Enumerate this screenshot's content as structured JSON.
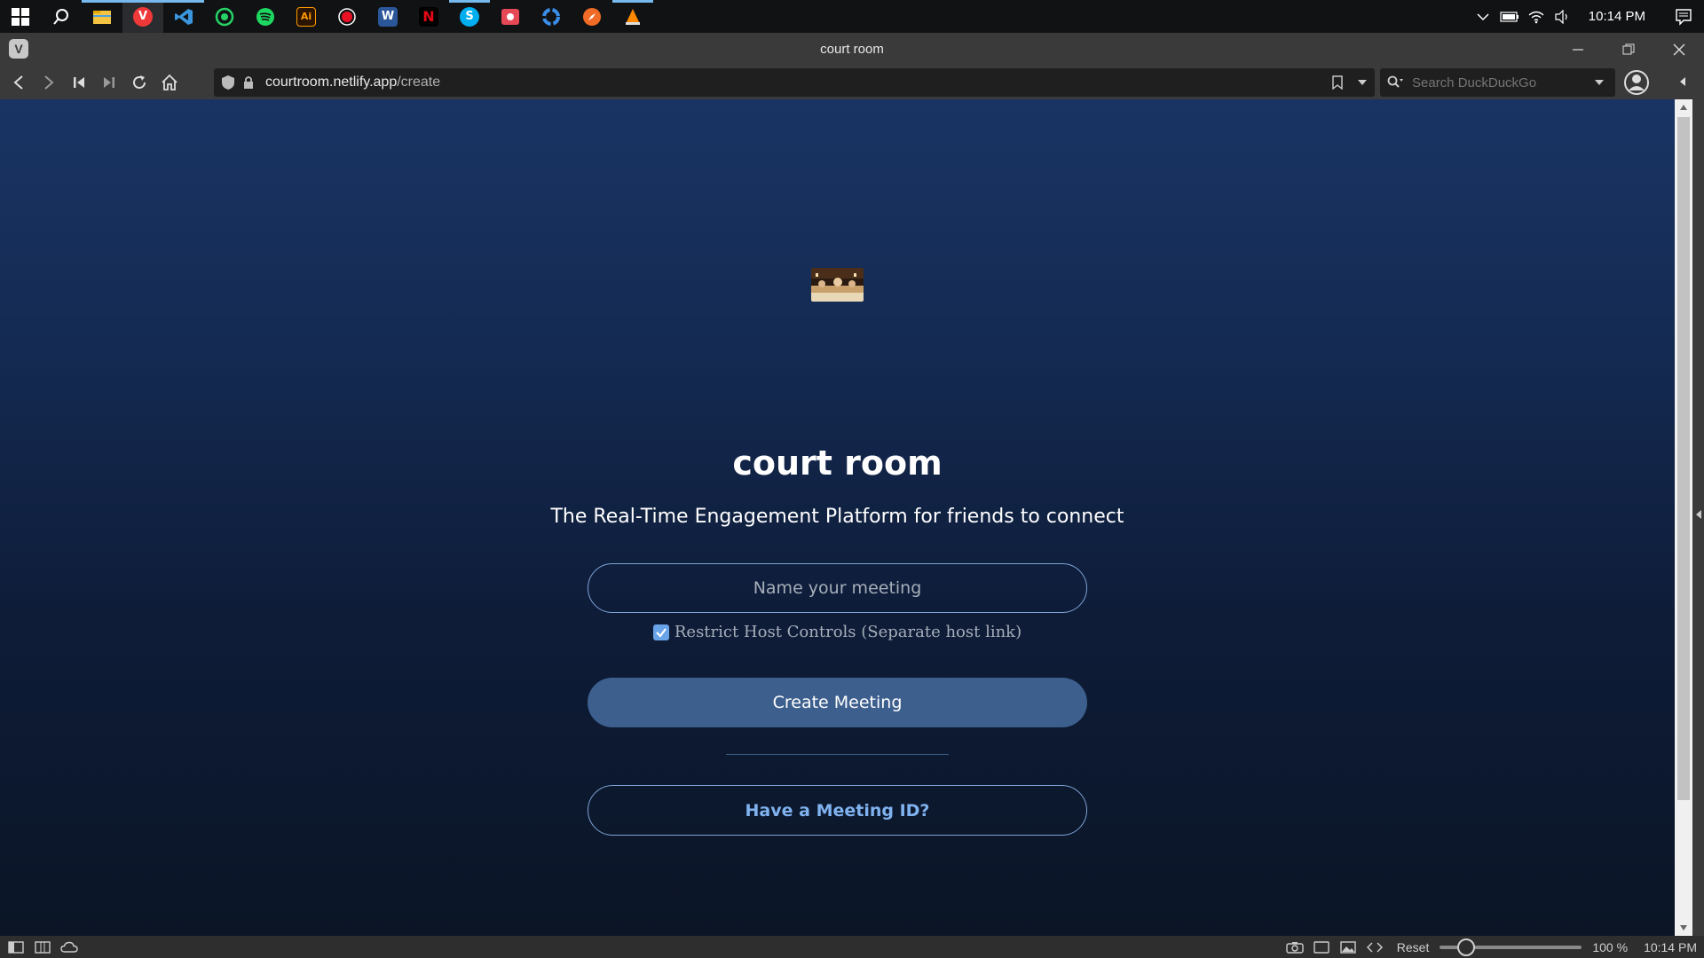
{
  "taskbar": {
    "apps": [
      {
        "name": "windows-start-icon"
      },
      {
        "name": "search-icon"
      },
      {
        "name": "file-explorer-icon",
        "color": "#f4c342"
      },
      {
        "name": "vivaldi-icon",
        "color": "#ef3939"
      },
      {
        "name": "vscode-icon",
        "color": "#3a96dd"
      },
      {
        "name": "whatsapp-icon",
        "color": "#25d366"
      },
      {
        "name": "spotify-icon",
        "color": "#1ed760"
      },
      {
        "name": "illustrator-icon",
        "color": "#ff9a00",
        "label": "Ai"
      },
      {
        "name": "record-icon",
        "color": "#e81123"
      },
      {
        "name": "word-icon",
        "color": "#2b579a",
        "label": "W"
      },
      {
        "name": "netflix-icon",
        "color": "#e50914",
        "label": "N"
      },
      {
        "name": "skype-icon",
        "color": "#00aff0",
        "label": "S"
      },
      {
        "name": "photo-icon",
        "color": "#e74856"
      },
      {
        "name": "recycle-icon",
        "color": "#3b8ee8"
      },
      {
        "name": "compass-icon",
        "color": "#f06b25"
      },
      {
        "name": "vlc-icon",
        "color": "#ff8800"
      }
    ],
    "clock": "10:14 PM"
  },
  "browser": {
    "tab_title": "court room",
    "url_host": "courtroom.netlify.app",
    "url_path": "/create",
    "search_placeholder": "Search DuckDuckGo"
  },
  "page": {
    "app_name": "court room",
    "tagline": "The Real-Time Engagement Platform for friends to connect",
    "meeting_name_placeholder": "Name your meeting",
    "meeting_name_value": "",
    "restrict_label": "Restrict Host Controls (Separate host link)",
    "restrict_checked": true,
    "create_button": "Create Meeting",
    "meeting_id_button": "Have a Meeting ID?"
  },
  "statusbar": {
    "reset_label": "Reset",
    "zoom": "100 %",
    "zoom_level": 1.0,
    "clock": "10:14 PM"
  },
  "colors": {
    "page_top": "#193464",
    "page_bottom": "#0b1526",
    "accent": "#3d5f8e",
    "link": "#7fb2ef"
  }
}
